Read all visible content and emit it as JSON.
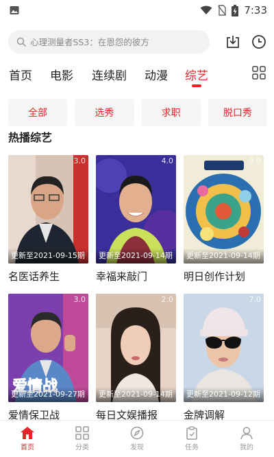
{
  "status": {
    "time": "7:33"
  },
  "search": {
    "placeholder": "心理测量者SS3：在恩怨的彼方"
  },
  "tabs": [
    {
      "label": "首页",
      "active": false
    },
    {
      "label": "电影",
      "active": false
    },
    {
      "label": "连续剧",
      "active": false
    },
    {
      "label": "动漫",
      "active": false
    },
    {
      "label": "综艺",
      "active": true
    }
  ],
  "filters": [
    "全部",
    "选秀",
    "求职",
    "脱口秀"
  ],
  "section": {
    "title": "热播综艺"
  },
  "cards": [
    {
      "title": "名医话养生",
      "score": "3.0",
      "update": "更新至2021-09-15期"
    },
    {
      "title": "幸福来敲门",
      "score": "4.0",
      "update": "更新至2021-09-14期"
    },
    {
      "title": "明日创作计划",
      "score": "9.0",
      "update": "更新至2021-09-14期"
    },
    {
      "title": "爱情保卫战",
      "score": "3.0",
      "update": "更新至2021-09-27期"
    },
    {
      "title": "每日文娱播报",
      "score": "2.0",
      "update": "更新至2021-09-14期"
    },
    {
      "title": "金牌调解",
      "score": "7.0",
      "update": "更新至2021-09-12期"
    }
  ],
  "poster_text": {
    "card4": "爱情战"
  },
  "nav": [
    {
      "label": "首页",
      "icon": "home-icon",
      "active": true
    },
    {
      "label": "分类",
      "icon": "category-grid-icon",
      "active": false
    },
    {
      "label": "发现",
      "icon": "compass-icon",
      "active": false
    },
    {
      "label": "任务",
      "icon": "task-clipboard-icon",
      "active": false
    },
    {
      "label": "我的",
      "icon": "user-icon",
      "active": false
    }
  ],
  "colors": {
    "accent": "#e8262a",
    "inactive": "#999999",
    "chip_bg": "#f5f5f5"
  }
}
